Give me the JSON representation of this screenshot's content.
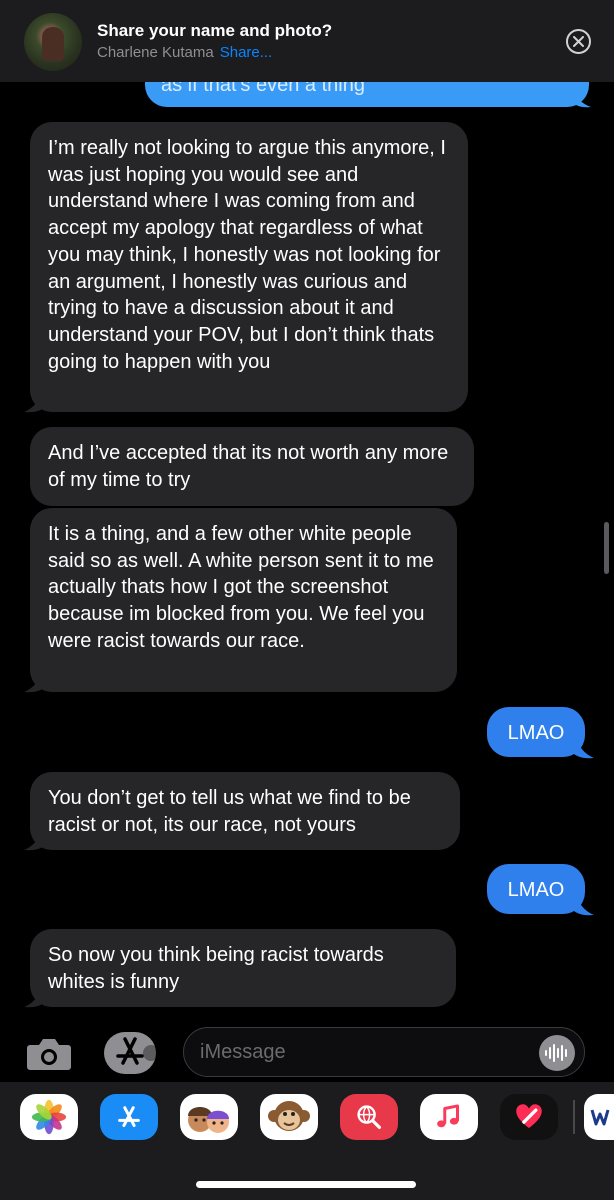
{
  "banner": {
    "title": "Share your name and photo?",
    "contact_name": "Charlene Kutama",
    "share_label": "Share..."
  },
  "messages": [
    {
      "direction": "sent",
      "partial": true,
      "text": "as if that's even a thing"
    },
    {
      "direction": "received",
      "text": "I’m really not looking to argue this anymore, I  was just hoping you would see and understand where I  was coming from and accept my apology that regardless of what you may think, I  honestly was not looking for an argument, I  honestly was curious and trying to have a discussion about it and understand your POV, but I  don’t think thats going to happen with you"
    },
    {
      "direction": "received",
      "text": "And I’ve accepted that its not worth any more of my time to try"
    },
    {
      "direction": "received",
      "text": "It is a thing, and a few other white people said so as well. A white person sent it to me actually thats how I  got the screenshot because im blocked from you. We feel you were racist towards our race."
    },
    {
      "direction": "sent",
      "text": "LMAO"
    },
    {
      "direction": "received",
      "text": "You don’t get to tell us what we find to be racist or not, its our race, not yours"
    },
    {
      "direction": "sent",
      "text": "LMAO"
    },
    {
      "direction": "received",
      "text": "So now you think being racist towards whites is funny"
    }
  ],
  "input": {
    "placeholder": "iMessage"
  },
  "app_drawer": [
    {
      "name": "photos-app-icon"
    },
    {
      "name": "app-store-icon"
    },
    {
      "name": "memoji-icon"
    },
    {
      "name": "animoji-monkey-icon"
    },
    {
      "name": "web-search-icon"
    },
    {
      "name": "music-icon"
    },
    {
      "name": "digital-touch-icon"
    }
  ],
  "colors": {
    "background": "#000000",
    "received_bubble": "#262629",
    "sent_bubble": "#2f80ed",
    "accent": "#0a84ff",
    "drawer": "#1c1c1e"
  }
}
